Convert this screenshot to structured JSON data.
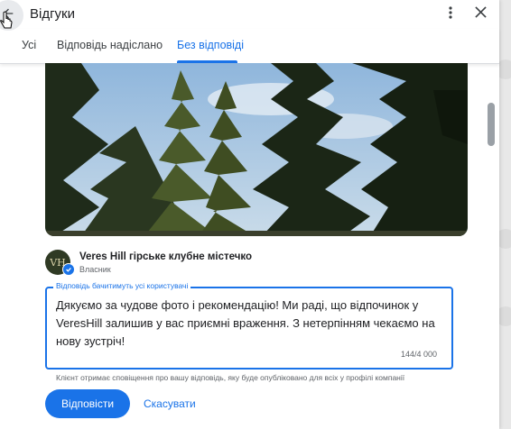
{
  "header": {
    "title": "Відгуки",
    "back_icon": "arrow-back-icon",
    "more_icon": "more-vert-icon",
    "close_icon": "close-icon"
  },
  "tabs": [
    {
      "label": "Усі",
      "active": false
    },
    {
      "label": "Відповідь надіслано",
      "active": false
    },
    {
      "label": "Без відповіді",
      "active": true
    }
  ],
  "owner": {
    "name": "Veres Hill гірське клубне містечко",
    "role": "Власник",
    "avatar_text": "VH"
  },
  "reply": {
    "label": "Відповідь бачитимуть усі користувачі",
    "text": "Дякуємо за чудове фото і рекомендацію! Ми раді, що відпочинок у VeresHill залишив у вас приємні враження. З нетерпінням чекаємо на нову зустріч!",
    "char_count": "144/4 000",
    "helper": "Клієнт отримає сповіщення про вашу відповідь, яку буде опубліковано для всіх у профілі компанії"
  },
  "actions": {
    "reply_label": "Відповісти",
    "cancel_label": "Скасувати"
  },
  "colors": {
    "accent": "#1a73e8"
  }
}
